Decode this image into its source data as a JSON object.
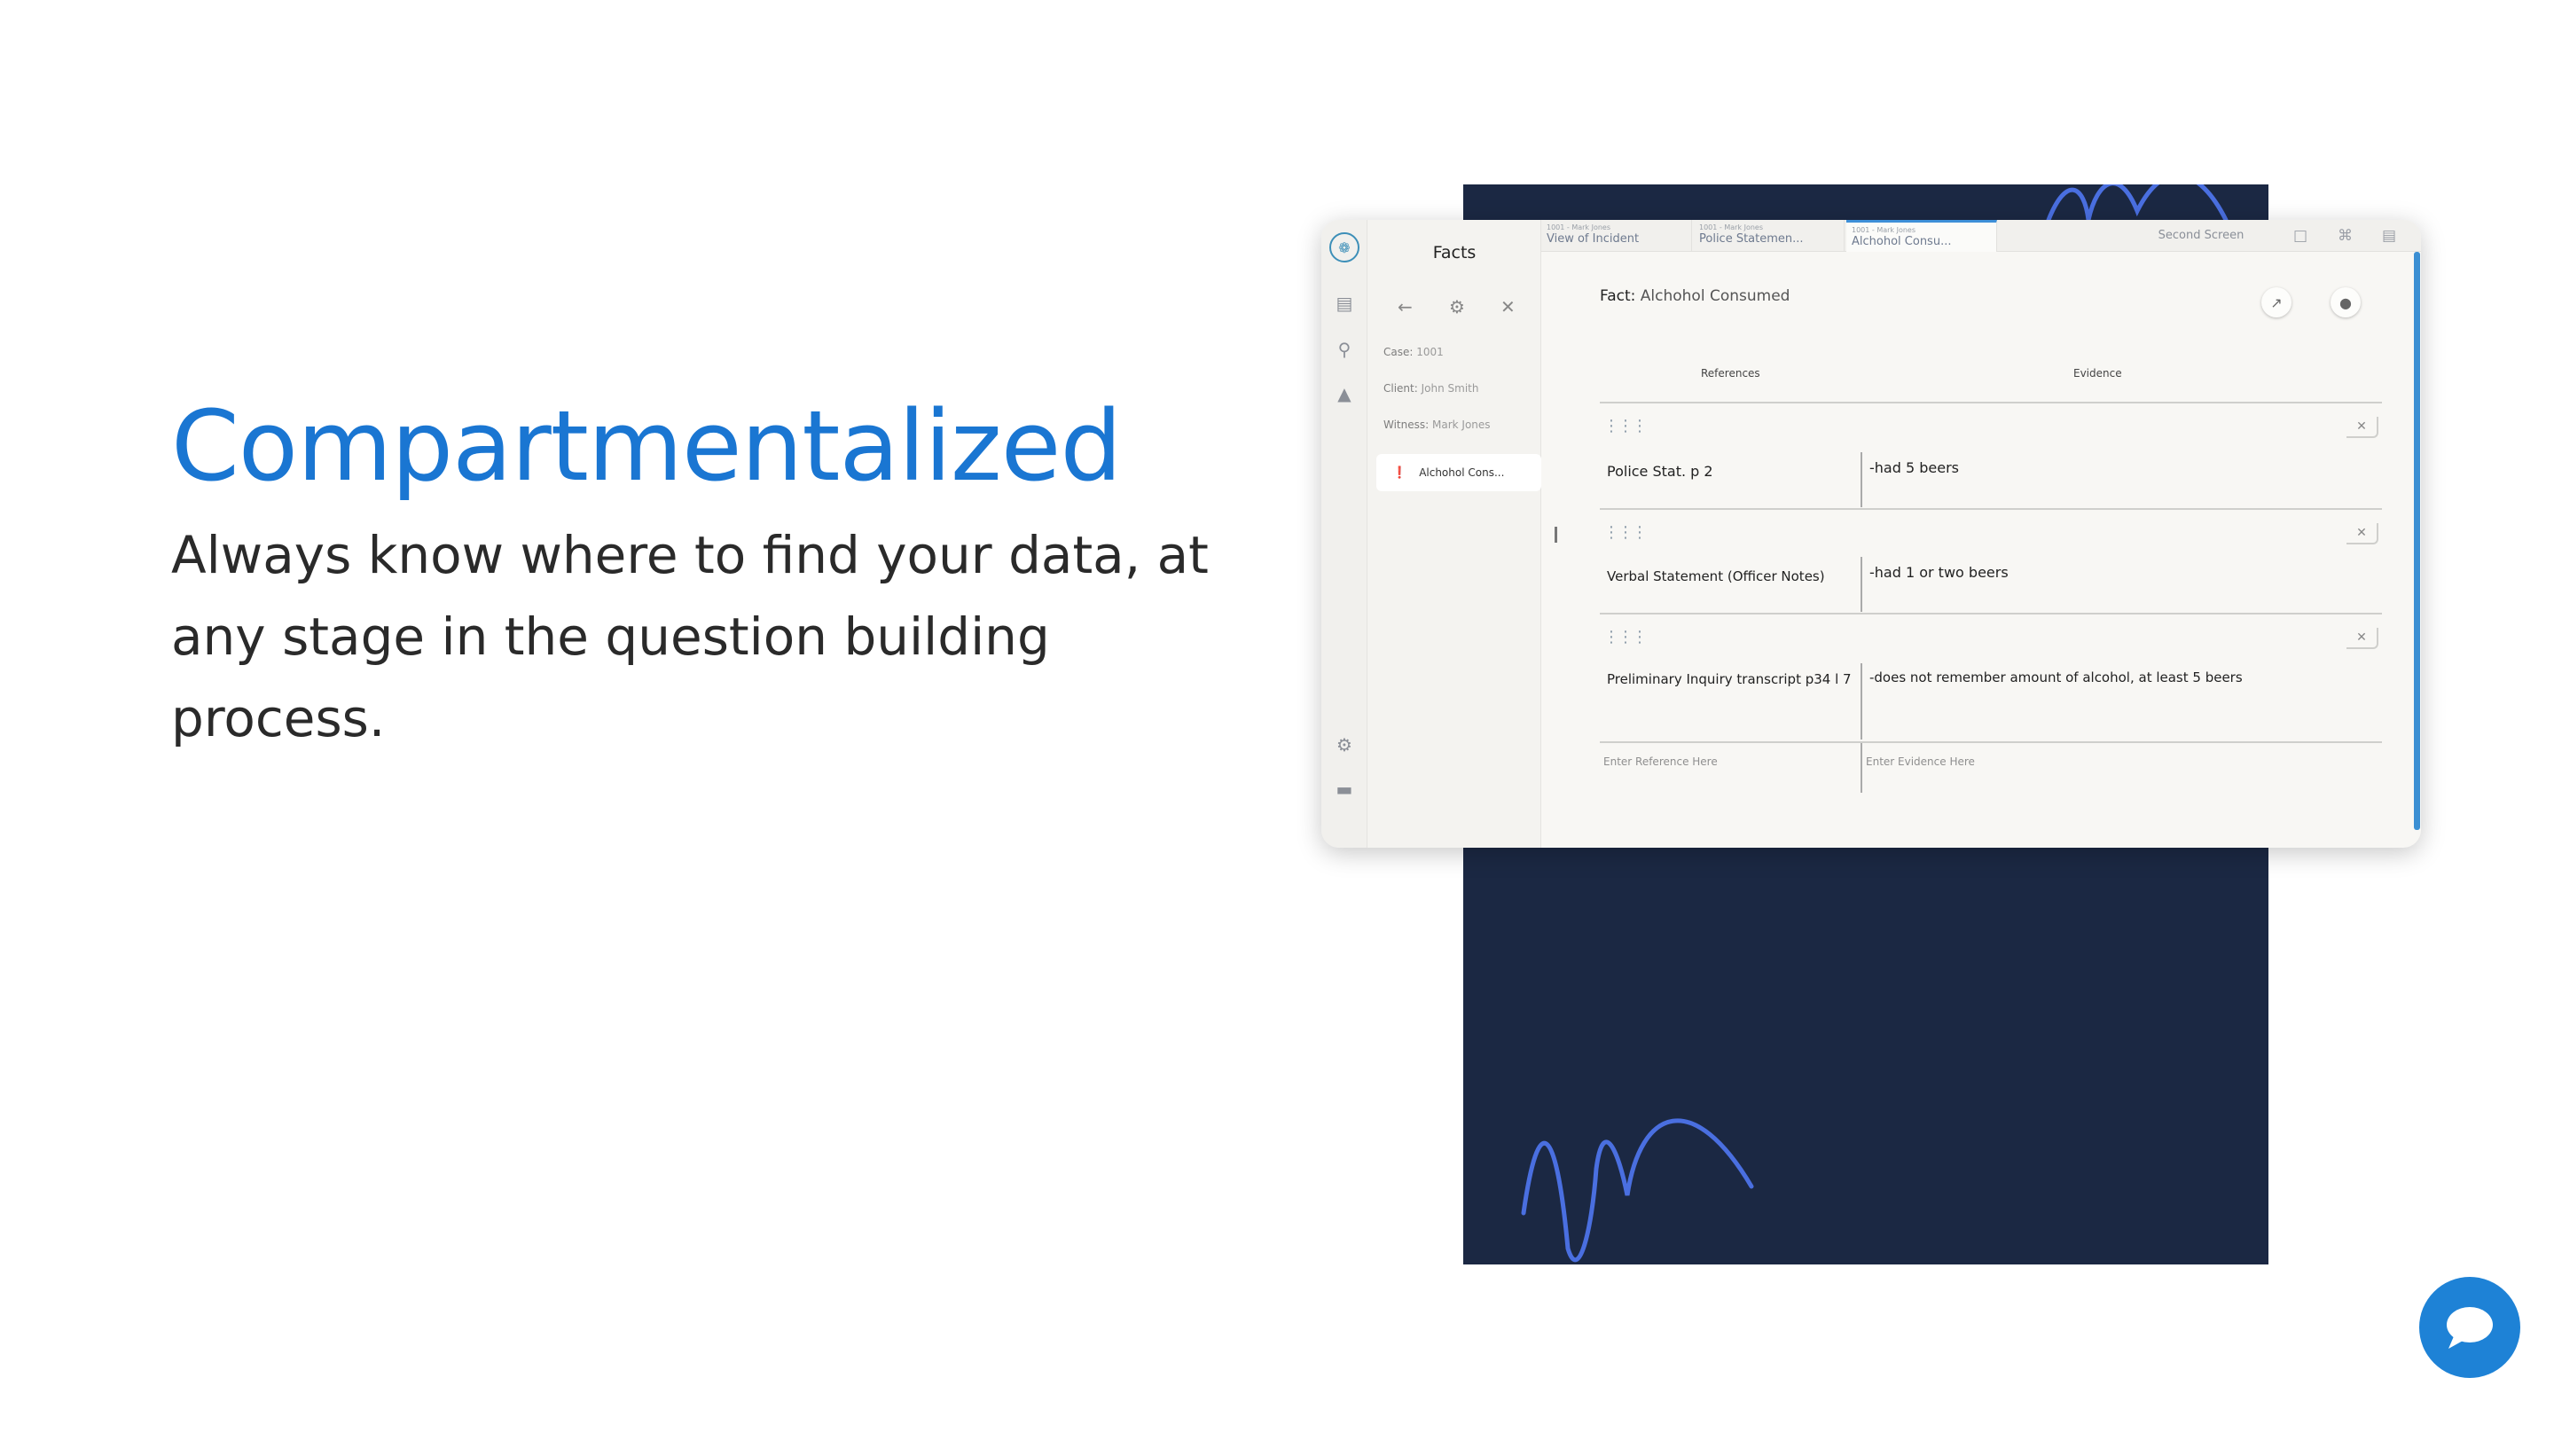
{
  "hero": {
    "title": "Compartmentalized",
    "description": "Always know where to find your data, at any stage in the question building process."
  },
  "colors": {
    "accent": "#1a76d2",
    "backdrop": "#1b2843",
    "squiggle": "#4a6fe0",
    "chat": "#1e82d6"
  },
  "sidebar_rail": {
    "icons": [
      "logo-icon",
      "document-search-icon",
      "chat-bubbles-icon",
      "bell-icon",
      "settings-icon",
      "logout-icon"
    ]
  },
  "facts_panel": {
    "title": "Facts",
    "case_label": "Case:",
    "case_value": "1001",
    "client_label": "Client:",
    "client_value": "John Smith",
    "witness_label": "Witness:",
    "witness_value": "Mark Jones",
    "selected_fact": "Alchohol Cons..."
  },
  "tabs": [
    {
      "sub": "1001 - Mark Jones",
      "name": "View of Incident"
    },
    {
      "sub": "1001 - Mark Jones",
      "name": "Police Statemen..."
    },
    {
      "sub": "1001 - Mark Jones",
      "name": "Alchohol Consu..."
    }
  ],
  "second_screen_label": "Second Screen",
  "fact": {
    "label": "Fact:",
    "name": "Alchohol Consumed",
    "col_references": "References",
    "col_evidence": "Evidence",
    "rows": [
      {
        "reference": "Police Stat. p 2",
        "evidence": "-had 5 beers"
      },
      {
        "reference": "Verbal Statement (Officer Notes)",
        "evidence": "-had 1 or two beers"
      },
      {
        "reference": "Preliminary Inquiry transcript p34 l 7",
        "evidence": "-does not remember amount of alcohol, at least 5 beers"
      }
    ],
    "reference_placeholder": "Enter Reference Here",
    "evidence_placeholder": "Enter Evidence Here"
  }
}
